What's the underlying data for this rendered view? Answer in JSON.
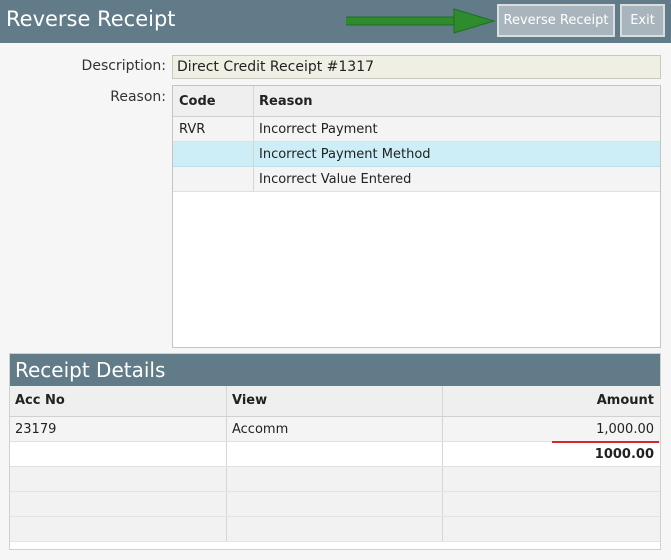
{
  "header": {
    "title": "Reverse Receipt",
    "reverse_button": "Reverse Receipt",
    "exit_button": "Exit"
  },
  "form": {
    "description_label": "Description:",
    "description_value": "Direct Credit Receipt #1317",
    "reason_label": "Reason:"
  },
  "reasons": {
    "headers": {
      "code": "Code",
      "reason": "Reason"
    },
    "rows": [
      {
        "code": "RVR",
        "reason": "Incorrect Payment"
      },
      {
        "code": "",
        "reason": "Incorrect Payment Method"
      },
      {
        "code": "",
        "reason": "Incorrect Value Entered"
      }
    ],
    "selected_index": 1
  },
  "receipt_details": {
    "title": "Receipt Details",
    "headers": {
      "acc_no": "Acc No",
      "view": "View",
      "amount": "Amount"
    },
    "rows": [
      {
        "acc_no": "23179",
        "view": "Accomm",
        "amount": "1,000.00"
      }
    ],
    "total": "1000.00"
  },
  "colors": {
    "header_bar": "#627b89",
    "selected_row": "#cdeef6",
    "annotation_arrow": "#2e8b2e",
    "annotation_underline": "#d9242b"
  }
}
